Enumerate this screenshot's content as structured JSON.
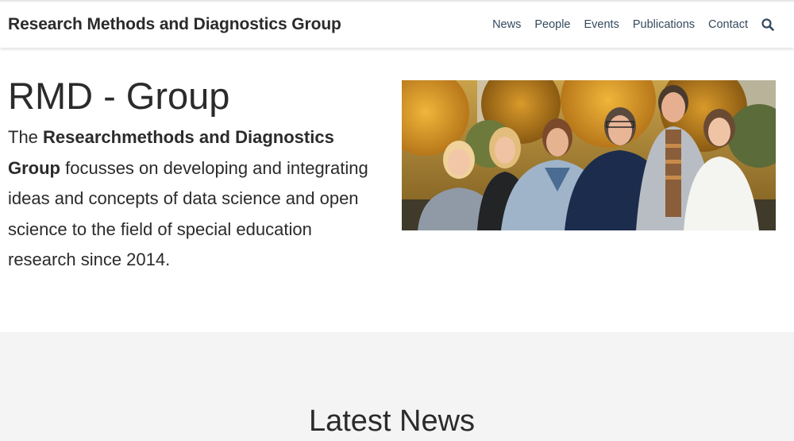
{
  "navbar": {
    "brand": "Research Methods and Diagnostics Group",
    "links": [
      {
        "label": "News"
      },
      {
        "label": "People"
      },
      {
        "label": "Events"
      },
      {
        "label": "Publications"
      },
      {
        "label": "Contact"
      }
    ],
    "search_icon": "search-icon"
  },
  "hero": {
    "title": "RMD - Group",
    "text_prefix": "The ",
    "text_bold": "Researchmethods and Diagnostics Group",
    "text_suffix": " focusses on developing and integrating ideas and concepts of data science and open science to the field of special education research since 2014."
  },
  "news": {
    "title": "Latest News"
  },
  "colors": {
    "nav_link": "#34495e",
    "text": "#2b2b2b",
    "news_bg": "#f4f4f4"
  }
}
